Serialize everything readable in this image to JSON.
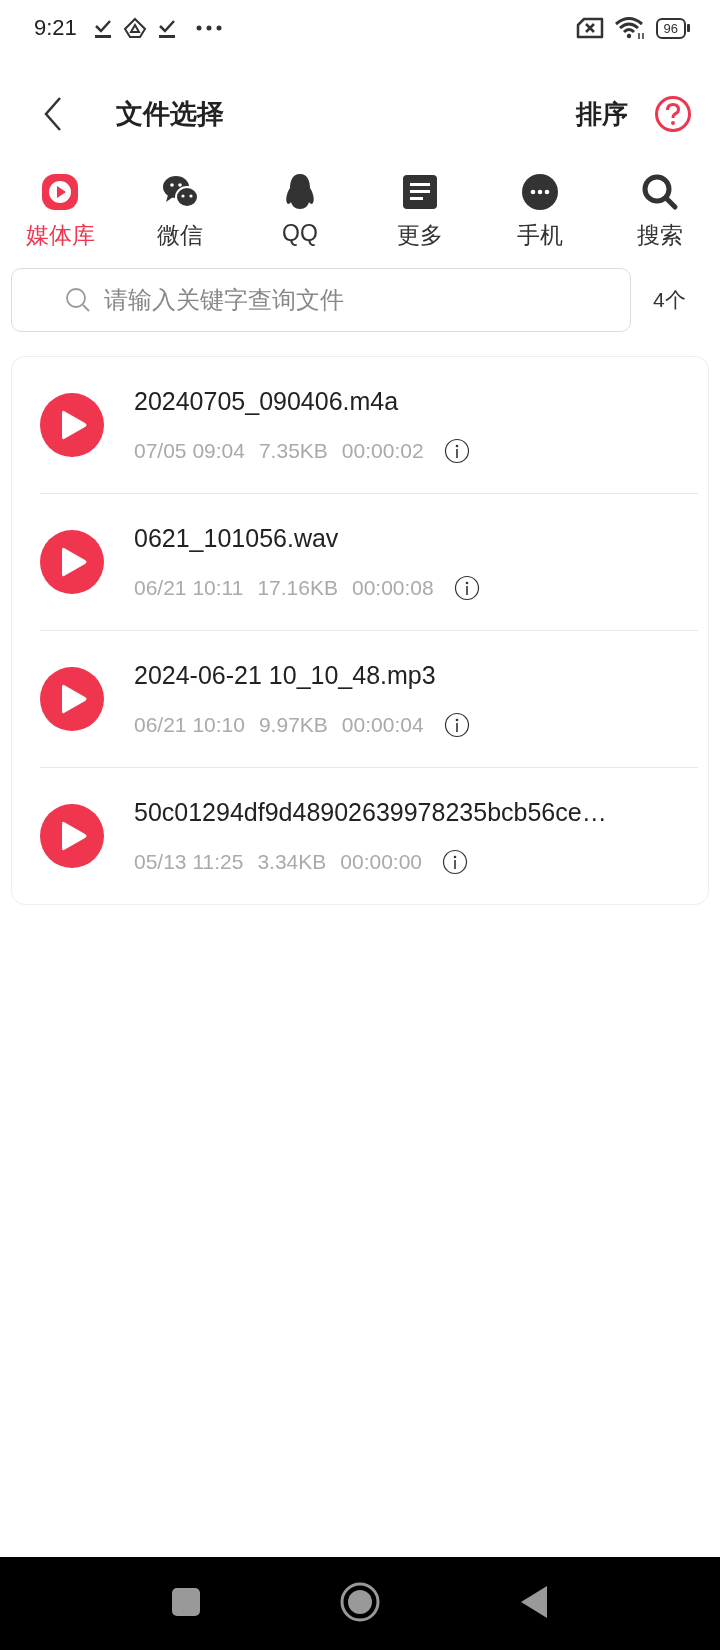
{
  "status_bar": {
    "time": "9:21",
    "battery": "96"
  },
  "header": {
    "title": "文件选择",
    "sort": "排序"
  },
  "tabs": [
    {
      "label": "媒体库",
      "kind": "media",
      "selected": true
    },
    {
      "label": "微信",
      "kind": "wechat",
      "selected": false
    },
    {
      "label": "QQ",
      "kind": "qq",
      "selected": false
    },
    {
      "label": "更多",
      "kind": "more",
      "selected": false
    },
    {
      "label": "手机",
      "kind": "phone",
      "selected": false
    },
    {
      "label": "搜索",
      "kind": "search",
      "selected": false
    }
  ],
  "search": {
    "placeholder": "请输入关键字查询文件",
    "count": "4个"
  },
  "files": [
    {
      "name": "20240705_090406.m4a",
      "date": "07/05 09:04",
      "size": "7.35KB",
      "duration": "00:00:02"
    },
    {
      "name": "0621_101056.wav",
      "date": "06/21 10:11",
      "size": "17.16KB",
      "duration": "00:00:08"
    },
    {
      "name": "2024-06-21 10_10_48.mp3",
      "date": "06/21 10:10",
      "size": "9.97KB",
      "duration": "00:00:04"
    },
    {
      "name": "50c01294df9d48902639978235bcb56ce…",
      "date": "05/13 11:25",
      "size": "3.34KB",
      "duration": "00:00:00"
    }
  ]
}
